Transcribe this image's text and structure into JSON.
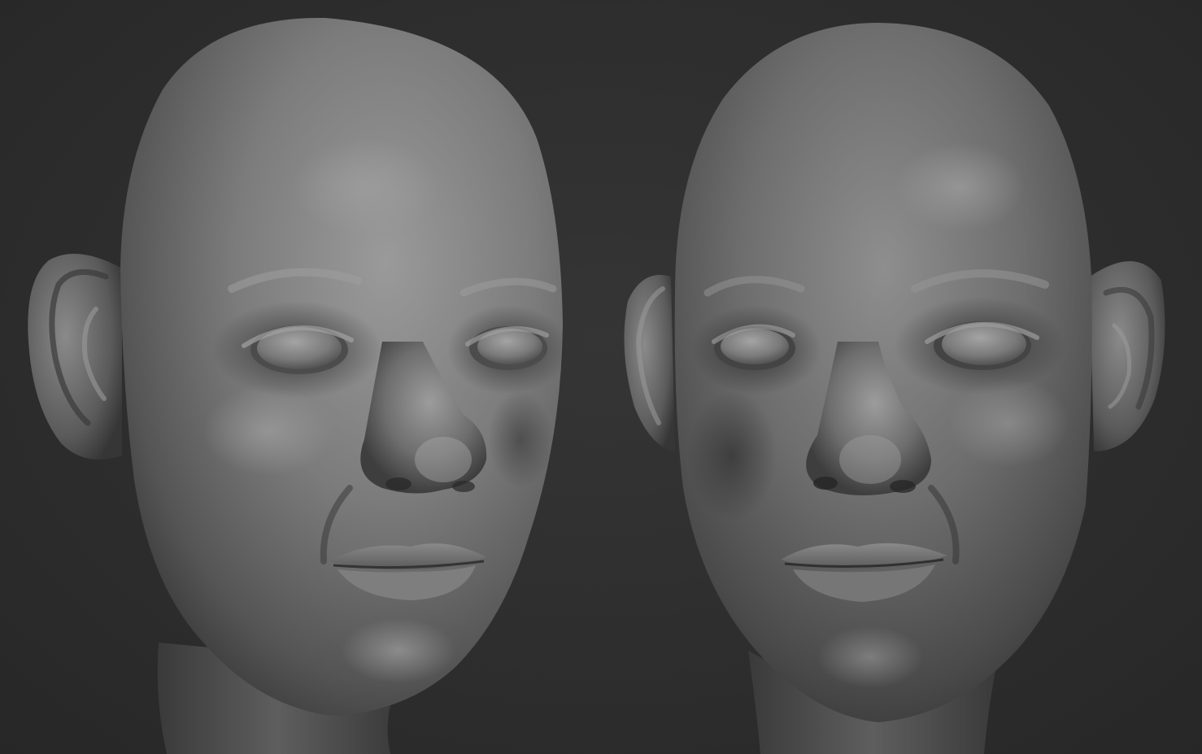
{
  "scene": {
    "background_color": "#2e2e2e",
    "material_color": "#7a7a7a",
    "views": [
      {
        "name": "left-head-render",
        "angle": "three-quarter-left"
      },
      {
        "name": "right-head-render",
        "angle": "three-quarter-right"
      }
    ]
  }
}
